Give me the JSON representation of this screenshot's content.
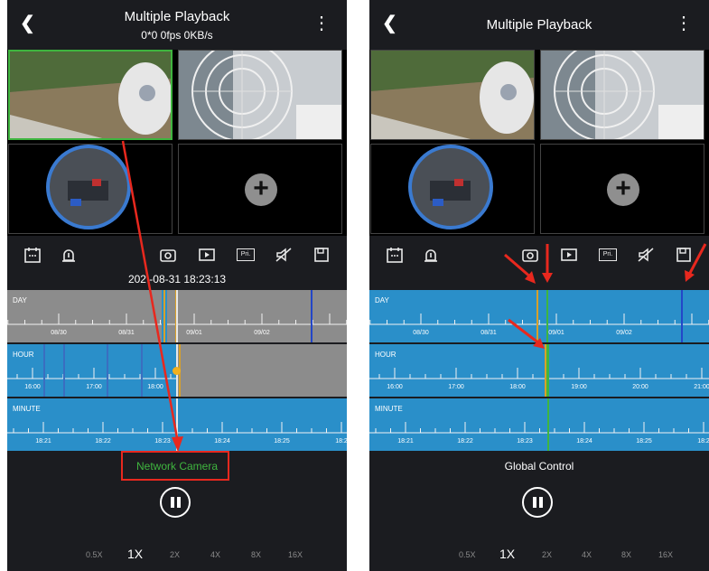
{
  "left": {
    "title": "Multiple Playback",
    "subtitle": "0*0  0fps  0KB/s",
    "datetime": "202 -08-31 18:23:13",
    "footer_label": "Network Camera",
    "footer_color": "#3fb53f",
    "day_band_color": "#8c8c8c",
    "hour_band_color": "#2a8fc9",
    "minute_band_color": "#2a8fc9"
  },
  "right": {
    "title": "Multiple Playback",
    "footer_label": "Global Control",
    "footer_color": "#ffffff",
    "day_band_color": "#2a8fc9",
    "hour_band_color": "#2a8fc9",
    "minute_band_color": "#2a8fc9"
  },
  "bands": {
    "day": {
      "label": "DAY",
      "ticks": [
        "08/30",
        "08/31",
        "09/01",
        "09/02"
      ]
    },
    "hour": {
      "label": "HOUR",
      "ticks": [
        "16:00",
        "17:00",
        "18:00",
        "19:00",
        "20:00",
        "21:00"
      ]
    },
    "minute": {
      "label": "MINUTE",
      "ticks": [
        "18:21",
        "18:22",
        "18:23",
        "18:24",
        "18:25",
        "18:2"
      ]
    }
  },
  "toolbar_icons": [
    "calendar-icon",
    "alarm-icon",
    "camera-icon",
    "record-icon",
    "pri-icon",
    "mute-icon",
    "save-icon"
  ],
  "pri_text": "Pri.",
  "speeds": [
    "0.5X",
    "1X",
    "2X",
    "4X",
    "8X",
    "16X"
  ],
  "selected_speed": "1X",
  "back_glyph": "❮",
  "more_glyph": "⋮",
  "add_glyph": "+",
  "annotation_color": "#e8281e"
}
